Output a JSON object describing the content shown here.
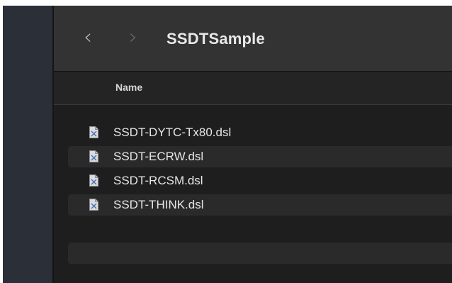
{
  "window": {
    "title": "SSDTSample"
  },
  "toolbar": {
    "back_icon": "chevron-left-icon",
    "forward_icon": "chevron-right-icon",
    "back_glyph": "‹",
    "forward_glyph": "›"
  },
  "columns": {
    "name": "Name"
  },
  "files": [
    {
      "name": "SSDT-DYTC-Tx80.dsl",
      "icon": "document-icon"
    },
    {
      "name": "SSDT-ECRW.dsl",
      "icon": "document-icon"
    },
    {
      "name": "SSDT-RCSM.dsl",
      "icon": "document-icon"
    },
    {
      "name": "SSDT-THINK.dsl",
      "icon": "document-icon"
    }
  ]
}
